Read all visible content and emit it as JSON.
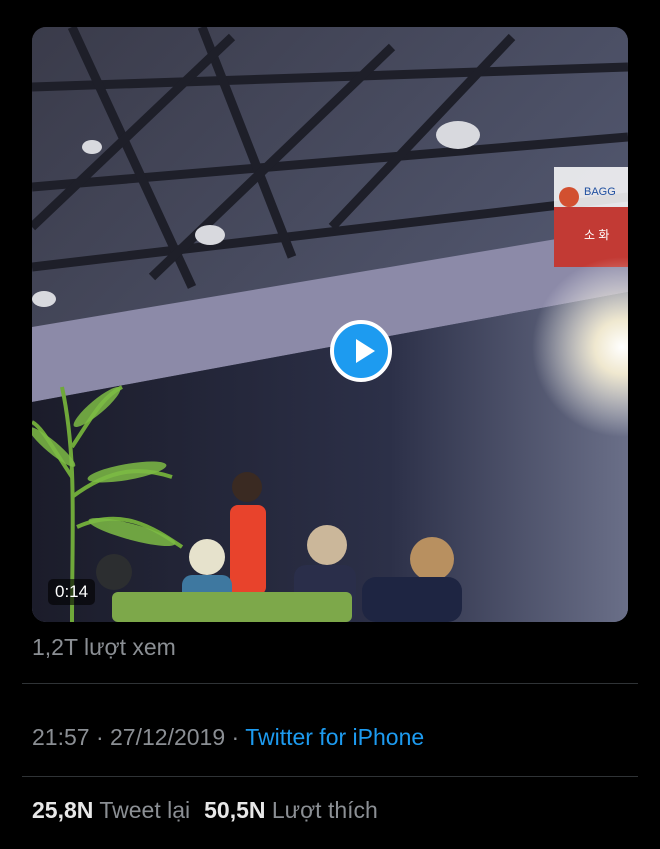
{
  "tweet": {
    "video": {
      "duration": "0:14",
      "play_icon": "play-icon",
      "sign_text_1": "BAGG",
      "sign_text_2": "소 화"
    },
    "views_label": "1,2T lượt xem",
    "time": "21:57",
    "separator": "·",
    "date": "27/12/2019",
    "source": "Twitter for iPhone",
    "retweets_count": "25,8N",
    "retweets_label": "Tweet lại",
    "likes_count": "50,5N",
    "likes_label": "Lượt thích"
  },
  "colors": {
    "background": "#000000",
    "accent": "#1d9bf0",
    "muted_text": "#8b8f94",
    "strong_text": "#e8e8e8"
  }
}
